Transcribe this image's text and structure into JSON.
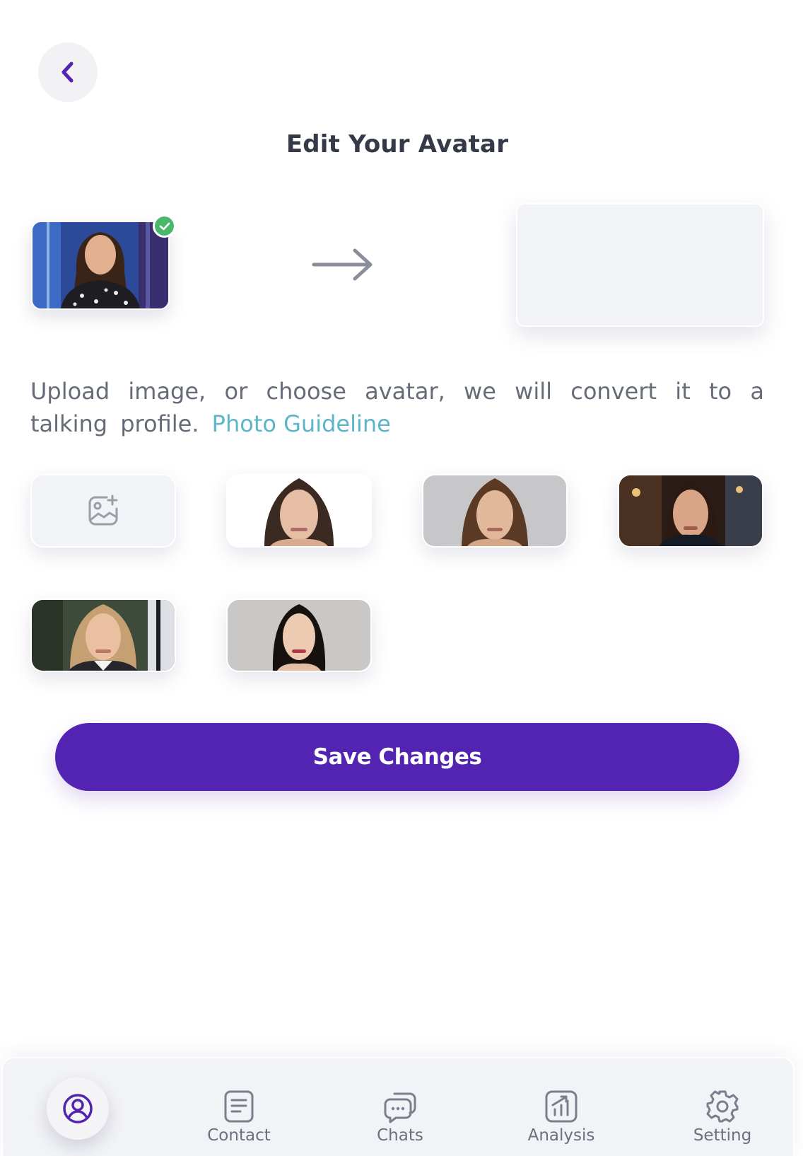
{
  "header": {
    "back_icon": "chevron-left-icon",
    "title": "Edit Your Avatar"
  },
  "preview": {
    "selected_badge_icon": "check-icon",
    "arrow_icon": "arrow-right-icon"
  },
  "description": {
    "text": "Upload image, or choose avatar, we will convert it to a talking profile.",
    "link": "Photo Guideline"
  },
  "avatars": {
    "upload_icon": "image-add-icon",
    "options": [
      {
        "name": "avatar-option-1"
      },
      {
        "name": "avatar-option-2"
      },
      {
        "name": "avatar-option-3"
      },
      {
        "name": "avatar-option-4"
      },
      {
        "name": "avatar-option-5"
      }
    ]
  },
  "actions": {
    "save_label": "Save Changes"
  },
  "nav": {
    "items": [
      {
        "label": "Contact",
        "icon": "contact-book-icon"
      },
      {
        "label": "Chats",
        "icon": "chat-bubbles-icon"
      },
      {
        "label": "Analysis",
        "icon": "analysis-chart-icon"
      },
      {
        "label": "Setting",
        "icon": "gear-icon"
      }
    ],
    "profile_icon": "user-circle-icon"
  },
  "colors": {
    "accent": "#5323b2",
    "link": "#5cb6c8",
    "success": "#4ab86a"
  }
}
